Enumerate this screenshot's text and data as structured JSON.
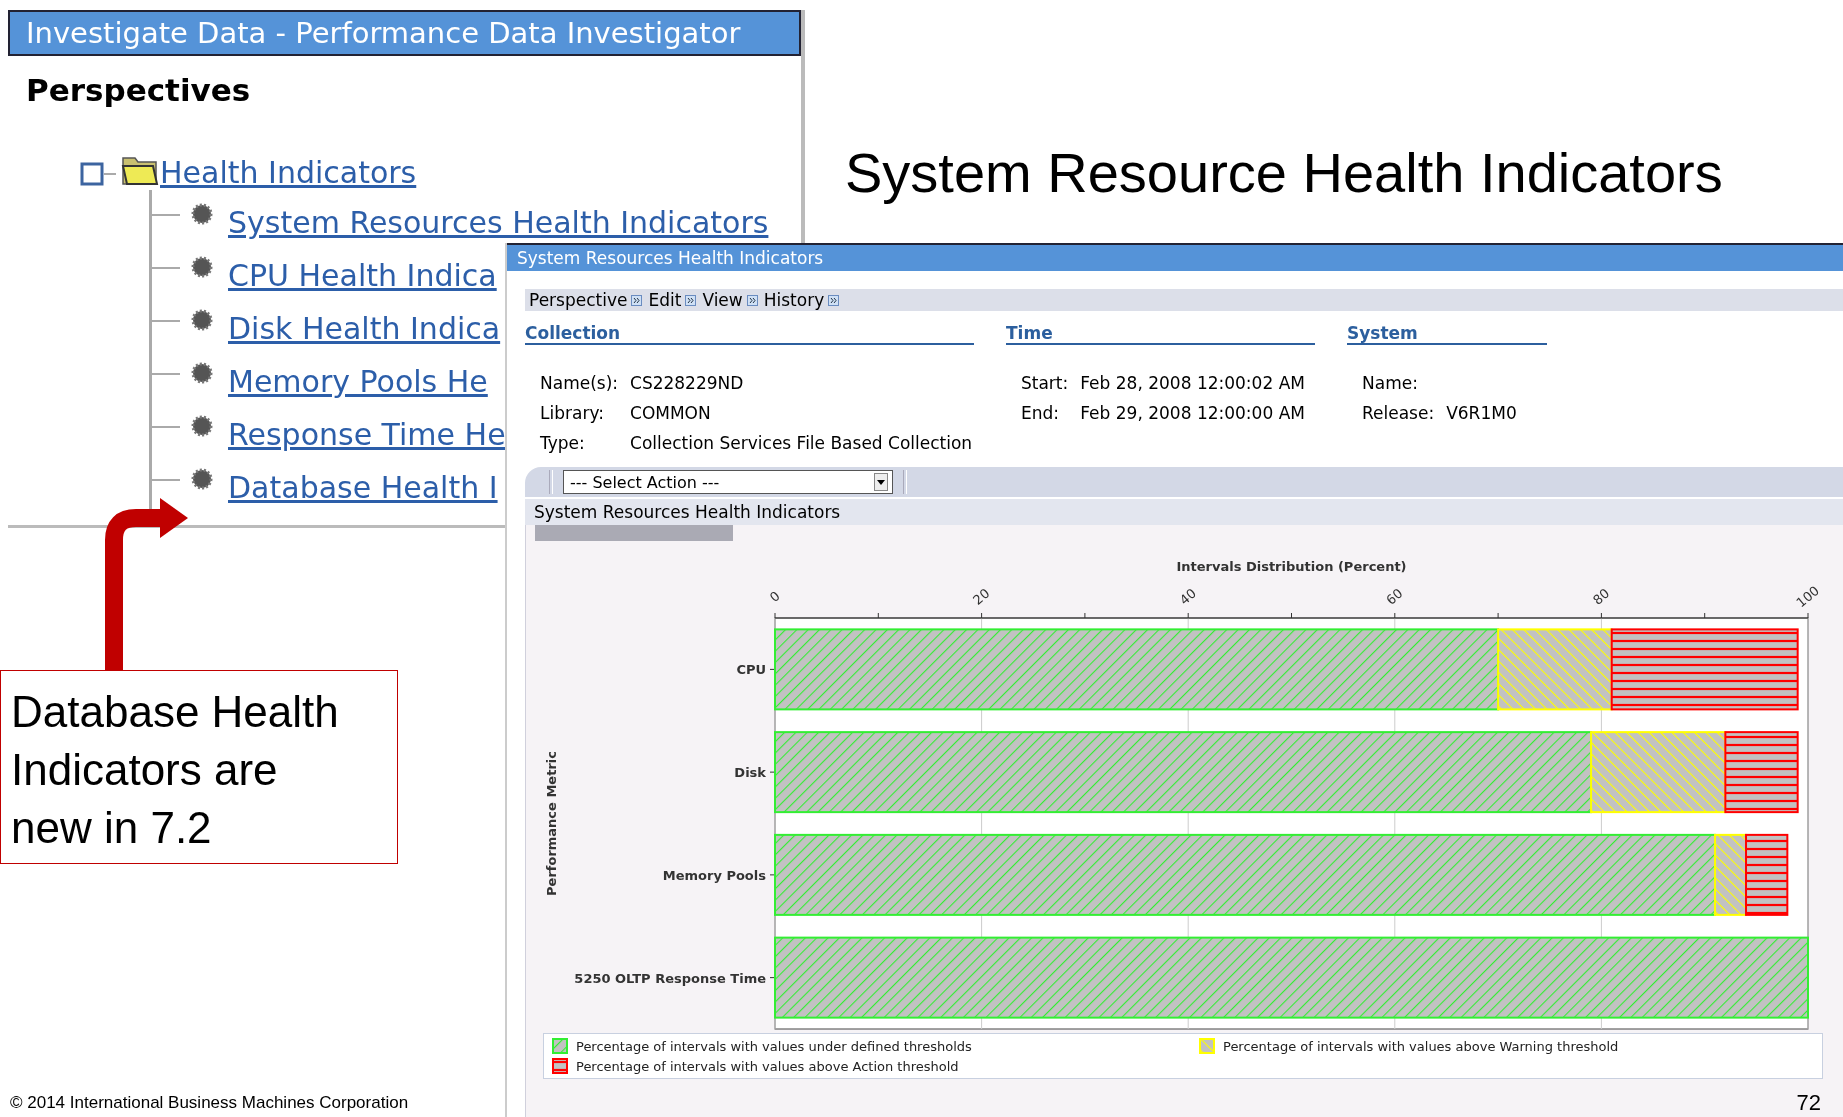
{
  "navigator_window": {
    "title": "Investigate Data - Performance Data Investigator",
    "heading": "Perspectives",
    "tree": [
      {
        "label": "Health Indicators",
        "expanded": true,
        "children": [
          {
            "label": "System Resources Health Indicators"
          },
          {
            "label": "CPU Health Indica"
          },
          {
            "label": "Disk Health Indica"
          },
          {
            "label": "Memory Pools He"
          },
          {
            "label": "Response Time He"
          },
          {
            "label": "Database Health I"
          }
        ]
      }
    ]
  },
  "slide": {
    "title": "System Resource Health Indicators",
    "callout": "Database Health Indicators are new in 7.2",
    "footer": "© 2014 International Business Machines Corporation",
    "page_number": "72"
  },
  "detail_window": {
    "title": "System Resources Health Indicators",
    "menu": [
      {
        "label": "Perspective"
      },
      {
        "label": "Edit"
      },
      {
        "label": "View"
      },
      {
        "label": "History"
      }
    ],
    "sections": [
      {
        "heading": "Collection",
        "fields": [
          {
            "label": "Name(s):",
            "value": "CS228229ND"
          },
          {
            "label": "Library:",
            "value": "COMMON"
          },
          {
            "label": "Type:",
            "value": "Collection Services File Based Collection"
          }
        ]
      },
      {
        "heading": "Time",
        "fields": [
          {
            "label": "Start:",
            "value": "Feb 28, 2008 12:00:02 AM"
          },
          {
            "label": "End:",
            "value": "Feb 29, 2008 12:00:00 AM"
          }
        ]
      },
      {
        "heading": "System",
        "fields": [
          {
            "label": "Name:"
          },
          {
            "label": "Release:",
            "value": "V6R1M0"
          }
        ]
      }
    ],
    "action_select": {
      "value": "--- Select Action ---"
    },
    "panel_title": "System Resources Health Indicators",
    "chart_data": {
      "type": "bar",
      "orientation": "horizontal",
      "stacked": true,
      "grid": true,
      "legend": true,
      "xlabel": "Intervals Distribution (Percent)",
      "ylabel": "Performance Metric",
      "xlim": [
        0,
        100
      ],
      "xticks": [
        0,
        20,
        40,
        60,
        80,
        100
      ],
      "categories": [
        "CPU",
        "Disk",
        "Memory Pools",
        "5250 OLTP Response Time"
      ],
      "series": [
        {
          "name": "Percentage of intervals with values under defined thresholds",
          "color": "#33ee33",
          "values": [
            70,
            79,
            91,
            100
          ]
        },
        {
          "name": "Percentage of intervals with values above Warning threshold",
          "color": "#ffff00",
          "values": [
            11,
            13,
            3,
            0
          ]
        },
        {
          "name": "Percentage of intervals with values above Action threshold",
          "color": "#ff0000",
          "values": [
            18,
            7,
            4,
            0
          ]
        }
      ]
    }
  }
}
